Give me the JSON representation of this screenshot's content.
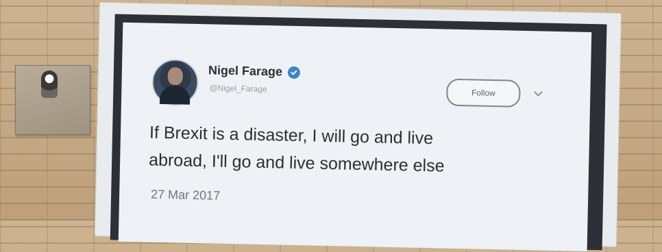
{
  "tweet": {
    "author_name": "Nigel Farage",
    "handle": "@Nigel_Farage",
    "follow_label": "Follow",
    "text_line1": "If Brexit is a disaster, I will go and live",
    "text_line2": "abroad, I'll go and live somewhere else",
    "date": "27 Mar 2017",
    "icons": [
      "verified-badge-icon",
      "chevron-down-icon"
    ]
  },
  "colors": {
    "verified_badge": "#3d86c6",
    "billboard_border": "#2d3036",
    "card_background": "#eef1f5",
    "brick_wall": "#c8ad8a"
  }
}
